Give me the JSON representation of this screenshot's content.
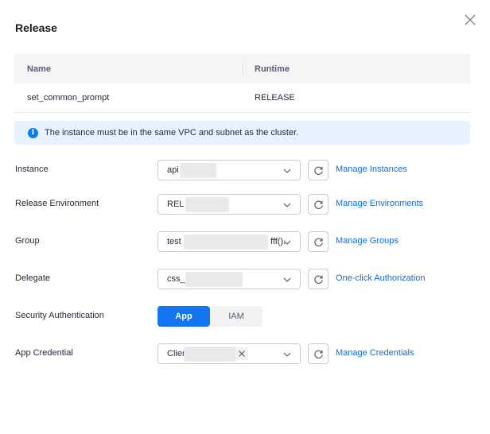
{
  "dialog": {
    "title": "Release"
  },
  "table": {
    "headers": [
      "Name",
      "Runtime"
    ],
    "rows": [
      {
        "name": "set_common_prompt",
        "runtime": "RELEASE"
      }
    ]
  },
  "alert": {
    "icon": "info-icon",
    "text": "The instance must be in the same VPC and subnet as the cluster."
  },
  "form": {
    "instance": {
      "label": "Instance",
      "value": "api",
      "link": "Manage Instances"
    },
    "environment": {
      "label": "Release Environment",
      "value": "REL",
      "link": "Manage Environments"
    },
    "group": {
      "label": "Group",
      "value": "test",
      "value_suffix": "fff().",
      "link": "Manage Groups"
    },
    "delegate": {
      "label": "Delegate",
      "value": "css_",
      "link": "One-click Authorization"
    },
    "security": {
      "label": "Security Authentication",
      "options": [
        "App",
        "IAM"
      ],
      "selected": "App"
    },
    "credential": {
      "label": "App Credential",
      "value": "Clier",
      "link": "Manage Credentials"
    }
  },
  "colors": {
    "primary": "#1475f0",
    "link": "#0b6fd6",
    "alert_bg": "#e6f2ff",
    "info": "#0b7ee8"
  }
}
